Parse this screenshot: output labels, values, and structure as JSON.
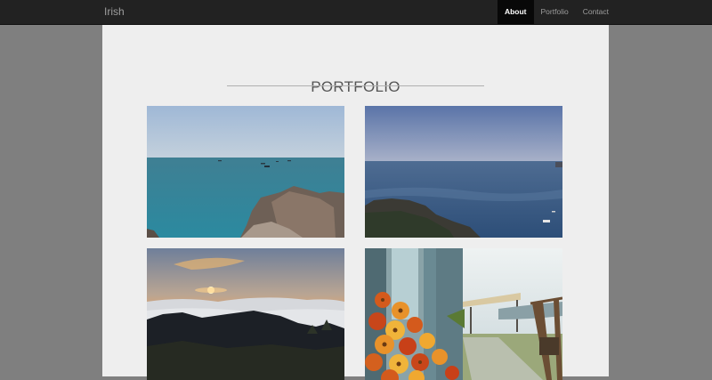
{
  "navbar": {
    "brand": "Irish",
    "items": [
      {
        "label": "About",
        "active": true
      },
      {
        "label": "Portfolio",
        "active": false
      },
      {
        "label": "Contact",
        "active": false
      }
    ]
  },
  "portfolio": {
    "title": "PORTFOLIO",
    "photos": [
      {
        "subject": "sea with rocky coast and boats"
      },
      {
        "subject": "calm sea at dusk with coastline"
      },
      {
        "subject": "sunset over sea of clouds and mountains"
      },
      {
        "subject": "orange flowers by a seaside terrace"
      }
    ]
  },
  "colors": {
    "navbar_bg": "#222222",
    "page_bg": "#7f7f7f",
    "content_bg": "#eeeeee",
    "active_nav_bg": "#080808"
  }
}
